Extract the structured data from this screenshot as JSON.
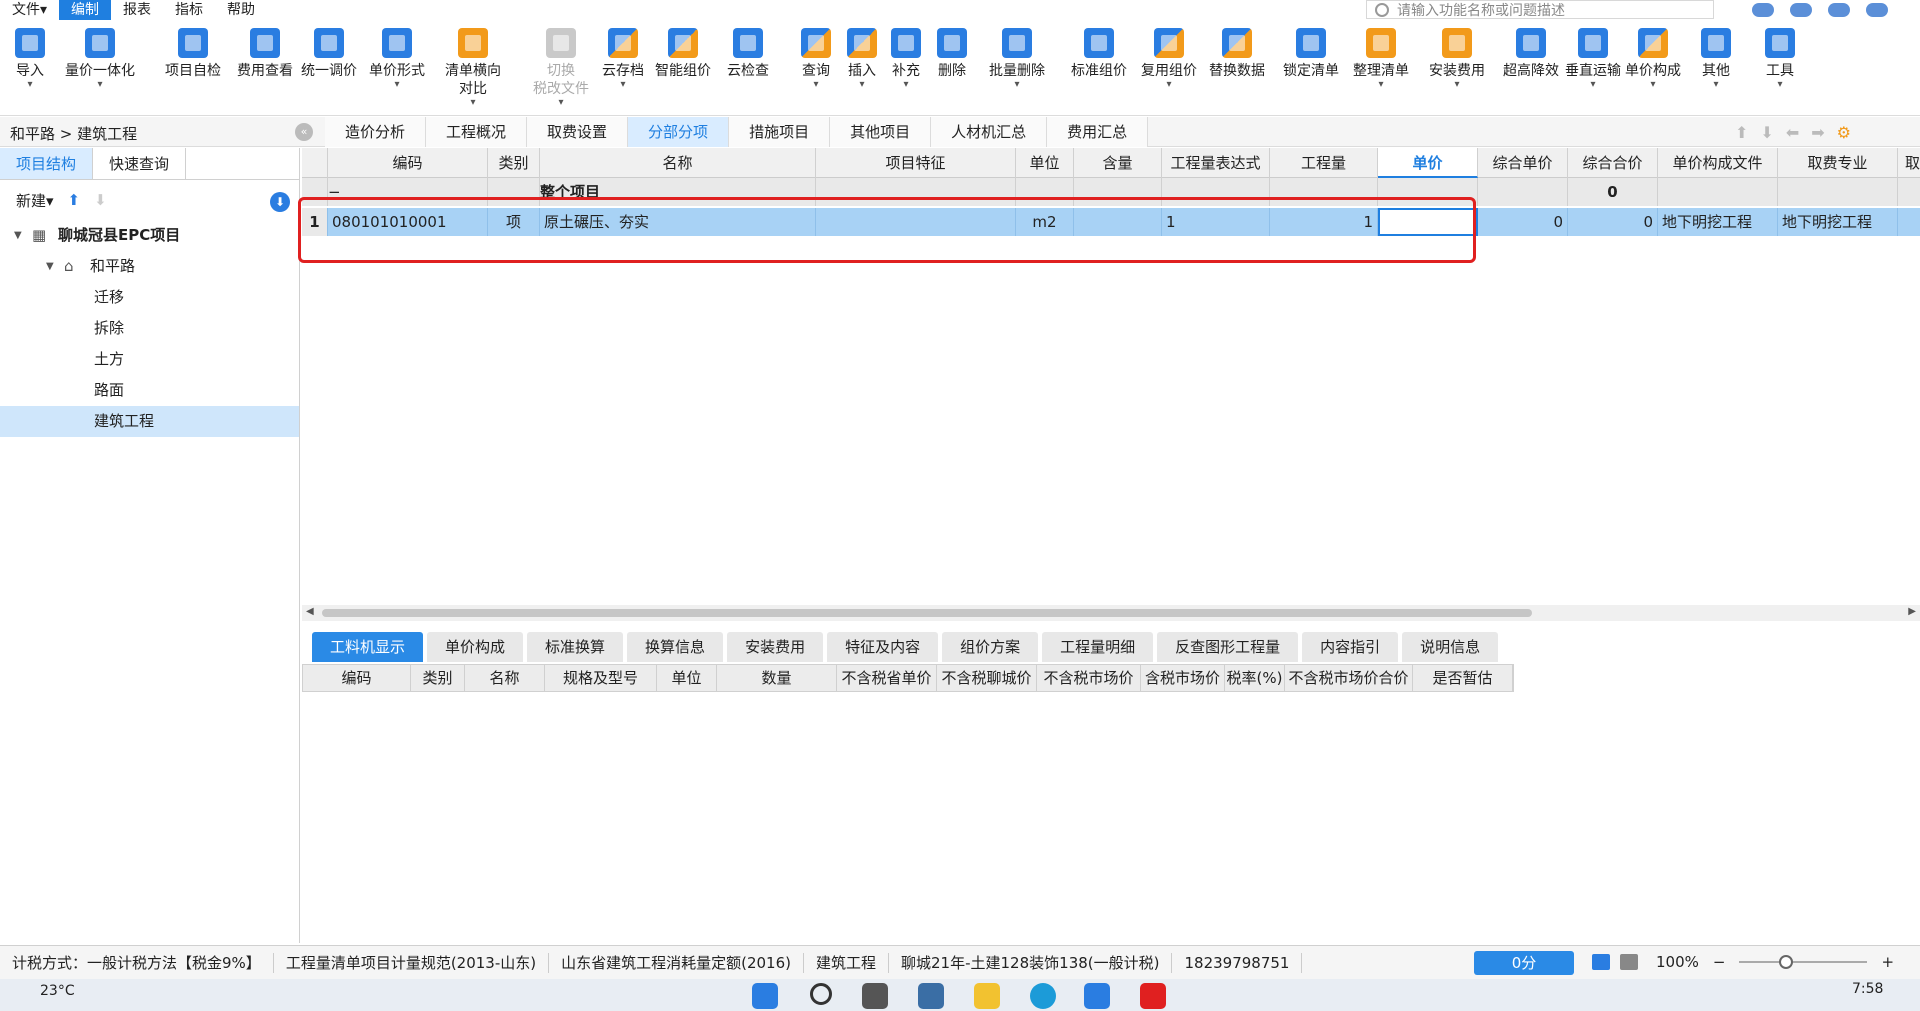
{
  "menubar": {
    "items": [
      "文件",
      "编制",
      "报表",
      "指标",
      "帮助"
    ],
    "file_arrow": "▾",
    "search_placeholder": "请输入功能名称或问题描述"
  },
  "toolbar": {
    "buttons": [
      {
        "label": "导入",
        "icon": "import-icon",
        "color": "blue"
      },
      {
        "label": "量价一体化",
        "icon": "integration-icon",
        "color": "blue"
      },
      {
        "label": "项目自检",
        "icon": "check-icon",
        "color": "blue"
      },
      {
        "label": "费用查看",
        "icon": "fee-view-icon",
        "color": "blue"
      },
      {
        "label": "统一调价",
        "icon": "price-adjust-icon",
        "color": "blue"
      },
      {
        "label": "单价形式",
        "icon": "unit-price-icon",
        "color": "blue"
      },
      {
        "label": "清单横向\n对比",
        "icon": "compare-icon",
        "color": "orange"
      },
      {
        "label": "切换\n税改文件",
        "icon": "switch-tax-icon",
        "color": "gray"
      },
      {
        "label": "云存档",
        "icon": "cloud-save-icon",
        "color": "mix"
      },
      {
        "label": "智能组价",
        "icon": "smart-pricing-icon",
        "color": "mix"
      },
      {
        "label": "云检查",
        "icon": "cloud-check-icon",
        "color": "blue"
      },
      {
        "label": "查询",
        "icon": "query-icon",
        "color": "mix"
      },
      {
        "label": "插入",
        "icon": "insert-icon",
        "color": "mix"
      },
      {
        "label": "补充",
        "icon": "supplement-icon",
        "color": "blue"
      },
      {
        "label": "删除",
        "icon": "delete-icon",
        "color": "blue"
      },
      {
        "label": "批量删除",
        "icon": "batch-delete-icon",
        "color": "blue"
      },
      {
        "label": "标准组价",
        "icon": "standard-pricing-icon",
        "color": "blue"
      },
      {
        "label": "复用组价",
        "icon": "reuse-pricing-icon",
        "color": "mix"
      },
      {
        "label": "替换数据",
        "icon": "replace-data-icon",
        "color": "mix"
      },
      {
        "label": "锁定清单",
        "icon": "lock-icon",
        "color": "blue"
      },
      {
        "label": "整理清单",
        "icon": "organize-icon",
        "color": "orange"
      },
      {
        "label": "安装费用",
        "icon": "install-fee-icon",
        "color": "orange"
      },
      {
        "label": "超高降效",
        "icon": "height-icon",
        "color": "blue"
      },
      {
        "label": "垂直运输",
        "icon": "vertical-transport-icon",
        "color": "blue"
      },
      {
        "label": "单价构成",
        "icon": "price-structure-icon",
        "color": "mix"
      },
      {
        "label": "其他",
        "icon": "other-icon",
        "color": "blue"
      },
      {
        "label": "工具",
        "icon": "tool-icon",
        "color": "blue"
      }
    ]
  },
  "breadcrumb": {
    "text": "和平路 > 建筑工程"
  },
  "main_tabs": [
    "造价分析",
    "工程概况",
    "取费设置",
    "分部分项",
    "措施项目",
    "其他项目",
    "人材机汇总",
    "费用汇总"
  ],
  "main_tab_active": "分部分项",
  "sidebar": {
    "tabs": [
      "项目结构",
      "快速查询"
    ],
    "new_label": "新建",
    "tree": [
      {
        "label": "聊城冠县EPC项目",
        "level": 0,
        "icon": "building-icon"
      },
      {
        "label": "和平路",
        "level": 1,
        "icon": "home-icon"
      },
      {
        "label": "迁移",
        "level": 2
      },
      {
        "label": "拆除",
        "level": 2
      },
      {
        "label": "土方",
        "level": 2
      },
      {
        "label": "路面",
        "level": 2
      },
      {
        "label": "建筑工程",
        "level": 2,
        "selected": true
      }
    ]
  },
  "grid": {
    "columns": [
      "",
      "编码",
      "类别",
      "名称",
      "项目特征",
      "单位",
      "含量",
      "工程量表达式",
      "工程量",
      "单价",
      "综合单价",
      "综合合价",
      "单价构成文件",
      "取费专业",
      "取"
    ],
    "summary_row": {
      "collapse": "−",
      "name": "整个项目",
      "total": "0"
    },
    "rows": [
      {
        "no": "1",
        "code": "080101010001",
        "type": "项",
        "name": "原土碾压、夯实",
        "feature": "",
        "unit": "m2",
        "content": "",
        "expr": "1",
        "qty": "1",
        "price": "",
        "comp_price": "0",
        "comp_total": "0",
        "structure_file": "地下明挖工程",
        "fee_major": "地下明挖工程"
      }
    ]
  },
  "bottom_tabs": [
    "工料机显示",
    "单价构成",
    "标准换算",
    "换算信息",
    "安装费用",
    "特征及内容",
    "组价方案",
    "工程量明细",
    "反查图形工程量",
    "内容指引",
    "说明信息"
  ],
  "bottom_columns": [
    "编码",
    "类别",
    "名称",
    "规格及型号",
    "单位",
    "数量",
    "不含税省单价",
    "不含税聊城价",
    "不含税市场价",
    "含税市场价",
    "税率(%)",
    "不含税市场价合价",
    "是否暂估"
  ],
  "status": {
    "tax_method": "计税方式：一般计税方法【税金9%】",
    "spec": "工程量清单项目计量规范(2013-山东)",
    "quota": "山东省建筑工程消耗量定额(2016)",
    "project": "建筑工程",
    "pricing": "聊城21年-土建128装饰138(一般计税)",
    "phone": "18239798751",
    "score": "0分",
    "zoom": "100%",
    "zoom_minus": "−",
    "zoom_plus": "+"
  },
  "taskbar": {
    "temp": "23°C",
    "time": "7:58"
  }
}
